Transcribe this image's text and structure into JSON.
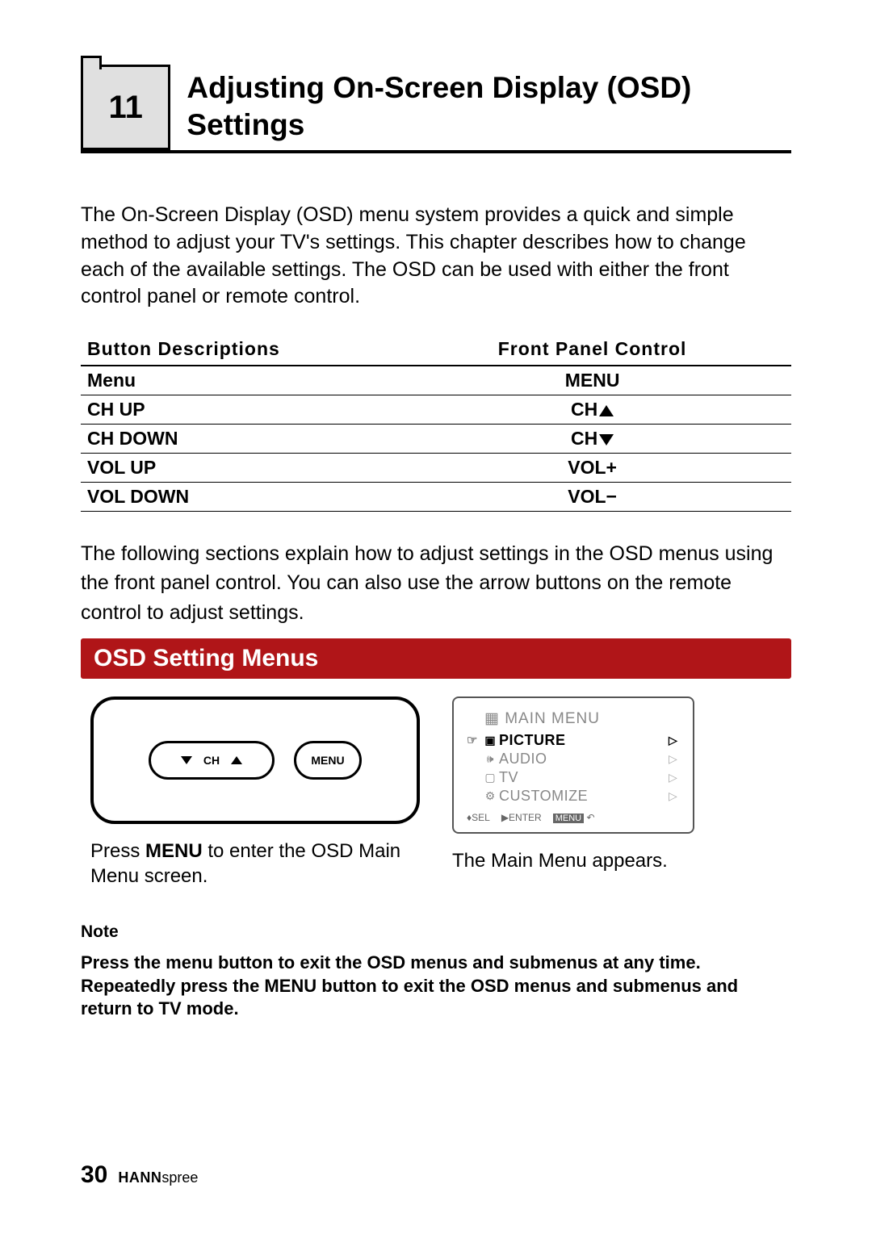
{
  "chapter": {
    "number": "11",
    "title": "Adjusting On-Screen Display (OSD) Settings"
  },
  "intro": "The On-Screen Display (OSD) menu system provides a quick and simple method to adjust your TV's settings. This chapter describes how to change each of the available settings. The OSD can be used with either the front control panel or remote control.",
  "button_table": {
    "headers": {
      "c1": "Button Descriptions",
      "c2": "Front Panel Control"
    },
    "rows": [
      {
        "desc": "Menu",
        "ctrl": "MENU",
        "suffix": ""
      },
      {
        "desc": "CH UP",
        "ctrl": "CH",
        "suffix": "up"
      },
      {
        "desc": "CH DOWN",
        "ctrl": "CH",
        "suffix": "down"
      },
      {
        "desc": "VOL UP",
        "ctrl": "VOL+",
        "suffix": ""
      },
      {
        "desc": "VOL DOWN",
        "ctrl": "VOL−",
        "suffix": ""
      }
    ]
  },
  "para2": "The following sections explain how to adjust settings in the OSD menus using the front panel control. You can also  use the arrow buttons on the remote control to adjust settings.",
  "osd_banner": "OSD Setting Menus",
  "panel": {
    "ch_label": "CH",
    "menu_label": "MENU"
  },
  "caption_left_pre": "Press ",
  "caption_left_bold": "MENU",
  "caption_left_post": " to enter the OSD Main Menu screen.",
  "caption_right": "The Main Menu appears.",
  "screen": {
    "title": "MAIN  MENU",
    "items": [
      {
        "label": "PICTURE",
        "active": true
      },
      {
        "label": "AUDIO",
        "active": false
      },
      {
        "label": "TV",
        "active": false
      },
      {
        "label": "CUSTOMIZE",
        "active": false
      }
    ],
    "hints": {
      "sel": "SEL",
      "enter": "ENTER",
      "menu": "MENU"
    }
  },
  "note_h": "Note",
  "note_b": "Press the menu button to exit the OSD menus and submenus at any time. Repeatedly press the MENU button to exit the OSD menus and submenus and return to TV mode.",
  "footer": {
    "page": "30",
    "brand_bold": "HANN",
    "brand_rest": "spree"
  }
}
